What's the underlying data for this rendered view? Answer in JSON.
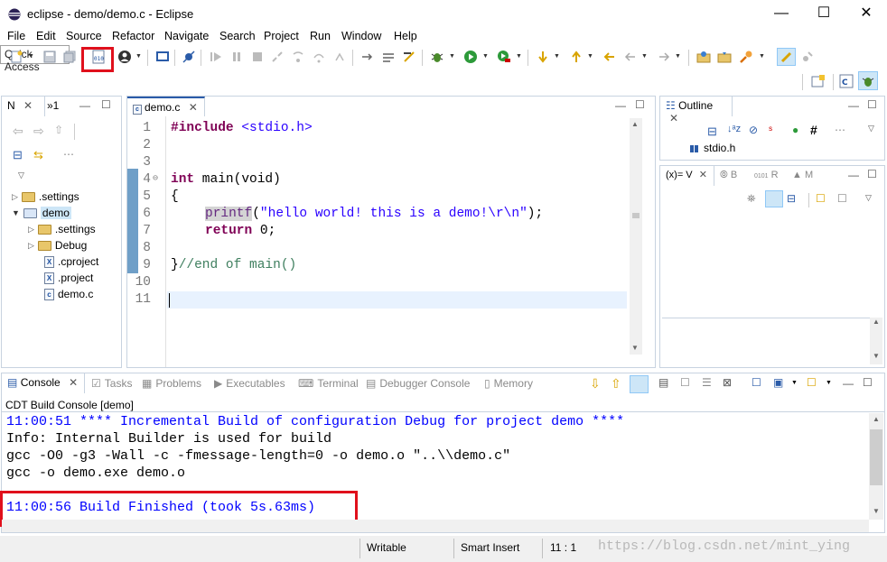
{
  "window": {
    "title": "eclipse - demo/demo.c - Eclipse",
    "minimize": "—",
    "maximize": "☐",
    "close": "✕"
  },
  "menu": [
    "File",
    "Edit",
    "Source",
    "Refactor",
    "Navigate",
    "Search",
    "Project",
    "Run",
    "Window",
    "Help"
  ],
  "toolbar": {
    "quick_access": "Quick Access"
  },
  "left_panel": {
    "tab_label": "N",
    "tab2_label": "»1",
    "tree": [
      {
        "label": ".settings"
      },
      {
        "label": "demo"
      },
      {
        "label": ".settings"
      },
      {
        "label": "Debug"
      },
      {
        "label": ".cproject"
      },
      {
        "label": ".project"
      },
      {
        "label": "demo.c"
      }
    ]
  },
  "editor": {
    "tab_label": "demo.c",
    "line_numbers": [
      "1",
      "2",
      "3",
      "4",
      "5",
      "6",
      "7",
      "8",
      "9",
      "10",
      "11"
    ],
    "lines": {
      "l1_directive": "#include",
      "l1_header": "<stdio.h>",
      "l4_type": "int",
      "l4_rest": " main(void)",
      "l5": "{",
      "l6_fn": "printf",
      "l6_open": "(",
      "l6_string": "\"hello world! this is a demo!\\r\\n\"",
      "l6_close": ");",
      "l7_kw": "return",
      "l7_rest": " 0;",
      "l9_brace": "}",
      "l9_comment": "//end of main()"
    }
  },
  "outline": {
    "tab_label": "Outline",
    "item": "stdio.h"
  },
  "variables": {
    "tab_label": "(x)= V",
    "tab2": "B",
    "tab3": "R",
    "tab4": "M"
  },
  "bottom_tabs": [
    {
      "label": "Console"
    },
    {
      "label": "Tasks"
    },
    {
      "label": "Problems"
    },
    {
      "label": "Executables"
    },
    {
      "label": "Terminal"
    },
    {
      "label": "Debugger Console"
    },
    {
      "label": "Memory"
    }
  ],
  "console": {
    "title": "CDT Build Console [demo]",
    "lines": [
      "11:00:51 **** Incremental Build of configuration Debug for project demo ****",
      "Info: Internal Builder is used for build",
      "gcc -O0 -g3 -Wall -c -fmessage-length=0 -o demo.o \"..\\\\demo.c\"",
      "gcc -o demo.exe demo.o",
      "",
      "11:00:56 Build Finished (took 5s.63ms)"
    ]
  },
  "status": {
    "writable": "Writable",
    "insert_mode": "Smart Insert",
    "position": "11 : 1",
    "watermark": "https://blog.csdn.net/mint_ying"
  },
  "colors": {
    "highlight_box": "#e0101c",
    "console_blue": "#0000ff",
    "keyword": "#7f0055",
    "string": "#2a00ff",
    "comment": "#3f7f5f"
  }
}
